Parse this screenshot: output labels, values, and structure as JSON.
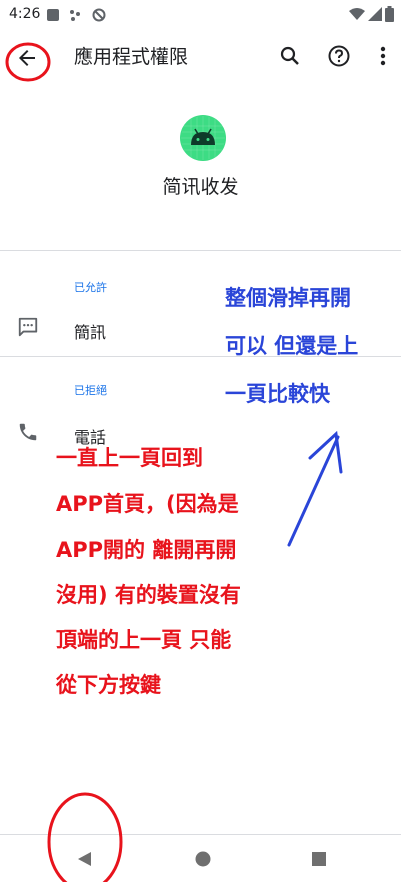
{
  "status_bar": {
    "time": "4:26",
    "icons": [
      "media-icon",
      "dots-icon",
      "circle-slash-icon",
      "wifi-icon",
      "signal-icon",
      "battery-icon"
    ]
  },
  "toolbar": {
    "back_icon": "arrow-back-icon",
    "title": "應用程式權限",
    "actions": [
      "search-icon",
      "help-icon",
      "more-vert-icon"
    ]
  },
  "app": {
    "icon": "android-icon",
    "icon_color": "#3ddc84",
    "name": "简讯收发"
  },
  "permissions": {
    "allowed_header": "已允許",
    "allowed_items": [
      {
        "label": "簡訊",
        "icon": "sms-icon"
      }
    ],
    "denied_header": "已拒絕",
    "denied_items": [
      {
        "label": "電話",
        "icon": "phone-icon"
      }
    ]
  },
  "navigation": {
    "buttons": [
      "nav-back-icon",
      "nav-home-icon",
      "nav-recents-icon"
    ]
  },
  "annotations": {
    "blue_note": [
      "整個滑掉再開",
      "可以 但還是上",
      "一頁比較快"
    ],
    "red_note": [
      "一直上一頁回到",
      "APP首頁，(因為是",
      "APP開的 離開再開",
      "沒用) 有的裝置沒有",
      "頂端的上一頁 只能",
      "從下方按鍵"
    ],
    "colors": {
      "blue": "#2a45d8",
      "red": "#e8131c"
    }
  }
}
